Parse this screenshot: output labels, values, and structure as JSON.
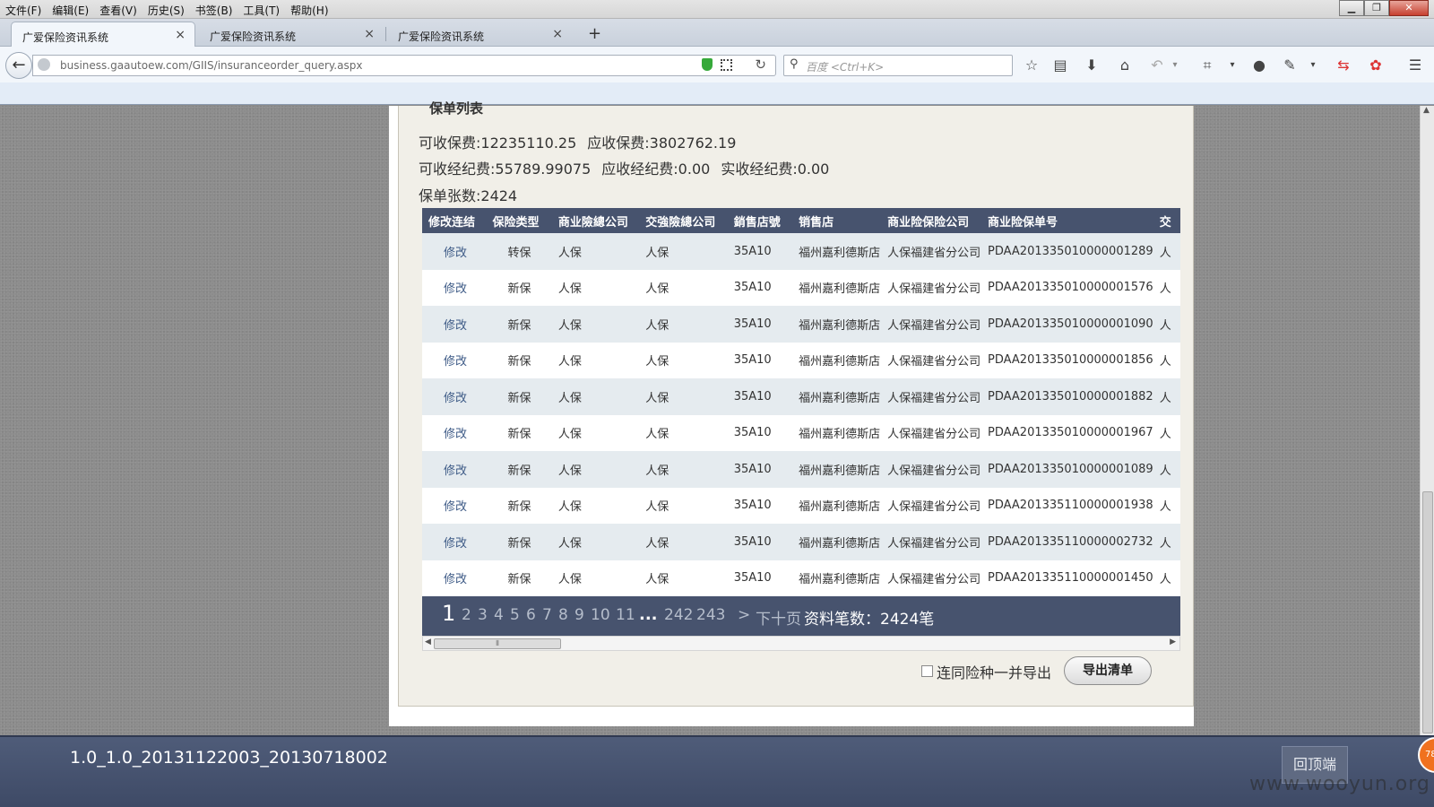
{
  "menu": [
    "文件(F)",
    "编辑(E)",
    "查看(V)",
    "历史(S)",
    "书签(B)",
    "工具(T)",
    "帮助(H)"
  ],
  "tabs": [
    {
      "label": "广爱保险资讯系统",
      "active": true
    },
    {
      "label": "广爱保险资讯系统",
      "active": false
    },
    {
      "label": "广爱保险资讯系统",
      "active": false
    }
  ],
  "newtab": "+",
  "url": "business.gaautoew.com/GIIS/insuranceorder_query.aspx",
  "search_placeholder": "百度 <Ctrl+K>",
  "section_title": "保单列表",
  "summary": {
    "line1": [
      "可收保费:12235110.25",
      "应收保费:3802762.19"
    ],
    "line2": [
      "可收经纪费:55789.99075",
      "应收经纪费:0.00",
      "实收经纪费:0.00"
    ],
    "line3": "保单张数:2424"
  },
  "table": {
    "headers": [
      "修改连结",
      "保险类型",
      "商业險總公司",
      "交強險總公司",
      "銷售店號",
      "销售店",
      "商业险保险公司",
      "商业险保单号",
      "交"
    ],
    "rows": [
      [
        "修改",
        "转保",
        "人保",
        "人保",
        "35A10",
        "福州嘉利德斯店",
        "人保福建省分公司",
        "PDAA201335010000001289",
        "人"
      ],
      [
        "修改",
        "新保",
        "人保",
        "人保",
        "35A10",
        "福州嘉利德斯店",
        "人保福建省分公司",
        "PDAA201335010000001576",
        "人"
      ],
      [
        "修改",
        "新保",
        "人保",
        "人保",
        "35A10",
        "福州嘉利德斯店",
        "人保福建省分公司",
        "PDAA201335010000001090",
        "人"
      ],
      [
        "修改",
        "新保",
        "人保",
        "人保",
        "35A10",
        "福州嘉利德斯店",
        "人保福建省分公司",
        "PDAA201335010000001856",
        "人"
      ],
      [
        "修改",
        "新保",
        "人保",
        "人保",
        "35A10",
        "福州嘉利德斯店",
        "人保福建省分公司",
        "PDAA201335010000001882",
        "人"
      ],
      [
        "修改",
        "新保",
        "人保",
        "人保",
        "35A10",
        "福州嘉利德斯店",
        "人保福建省分公司",
        "PDAA201335010000001967",
        "人"
      ],
      [
        "修改",
        "新保",
        "人保",
        "人保",
        "35A10",
        "福州嘉利德斯店",
        "人保福建省分公司",
        "PDAA201335010000001089",
        "人"
      ],
      [
        "修改",
        "新保",
        "人保",
        "人保",
        "35A10",
        "福州嘉利德斯店",
        "人保福建省分公司",
        "PDAA201335110000001938",
        "人"
      ],
      [
        "修改",
        "新保",
        "人保",
        "人保",
        "35A10",
        "福州嘉利德斯店",
        "人保福建省分公司",
        "PDAA201335110000002732",
        "人"
      ],
      [
        "修改",
        "新保",
        "人保",
        "人保",
        "35A10",
        "福州嘉利德斯店",
        "人保福建省分公司",
        "PDAA201335110000001450",
        "人"
      ]
    ]
  },
  "pager": {
    "current": "1",
    "pages": [
      "2",
      "3",
      "4",
      "5",
      "6",
      "7",
      "8",
      "9",
      "10",
      "11"
    ],
    "ellipsis": "...",
    "tail": [
      "242",
      "243"
    ],
    "next": ">",
    "next10": "下十页",
    "total": "资料笔数：2424笔"
  },
  "export": {
    "checkbox_label": "连同险种一并导出",
    "button": "导出清单"
  },
  "footer": {
    "version": "1.0_1.0_20131122003_20130718002",
    "back_to_top": "回顶端",
    "badge": "78",
    "watermark": "www.wooyun.org"
  },
  "colors": {
    "header_bg": "#47536e",
    "row_alt": "#e5ebef",
    "footer_bg": "#4f5c79"
  }
}
